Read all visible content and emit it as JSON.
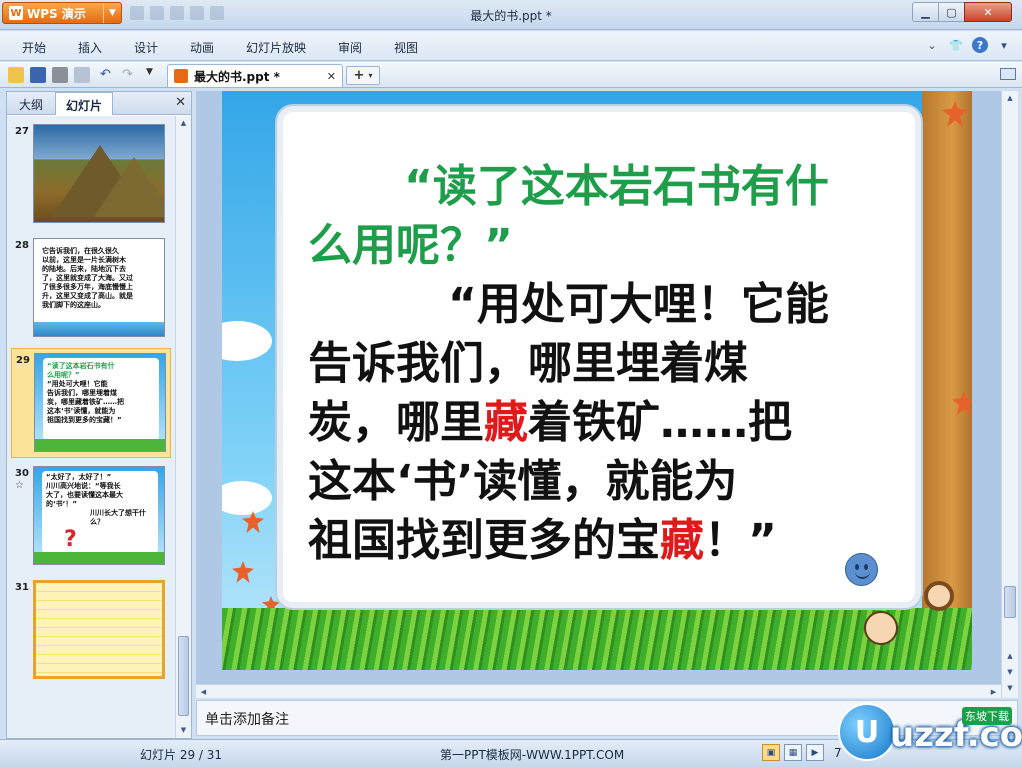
{
  "window": {
    "app_name": "WPS 演示",
    "app_logo": "W",
    "title": "最大的书.ppt *"
  },
  "menu": {
    "items": [
      "开始",
      "插入",
      "设计",
      "动画",
      "幻灯片放映",
      "审阅",
      "视图"
    ]
  },
  "toolbar": {
    "doc_tab_label": "最大的书.ppt *",
    "new_tab_label": "+"
  },
  "left_panel": {
    "tabs": [
      "大纲",
      "幻灯片"
    ],
    "slides": [
      {
        "num": "27",
        "lines": []
      },
      {
        "num": "28",
        "lines": [
          "它告诉我们，在很久很久",
          "以前，这里是一片长满树木",
          "的陆地。后来，陆地沉下去",
          "了，这里就变成了大海。又过",
          "了很多很多万年，海底慢慢上",
          "升，这里又变成了高山。就是",
          "我们脚下的这座山。"
        ]
      },
      {
        "num": "29",
        "lines": [
          "“读了这本岩石书有什",
          "么用呢？”",
          "“用处可大哩！它能",
          "告诉我们，哪里埋着煤",
          "炭，哪里藏着铁矿……把",
          "这本‘书’读懂，就能为",
          "祖国找到更多的宝藏！”"
        ]
      },
      {
        "num": "30",
        "star": "☆",
        "lines": [
          "“太好了，太好了！”",
          "川川高兴地说：“等我长",
          "大了，也要读懂这本最大",
          "的‘书’！”",
          "川川长大了想干什",
          "么？"
        ]
      },
      {
        "num": "31",
        "lines": []
      }
    ]
  },
  "slide": {
    "question": "“读了这本岩石书有什么用呢？”",
    "q_line1": "“读了这本岩石书有什",
    "q_line2": "么用呢？”",
    "a_line1": "“用处可大哩！它能",
    "a_line2": "告诉我们，哪里埋着煤",
    "a_line3a": "炭，哪里",
    "a_line3red": "藏",
    "a_line3b": "着铁矿……把",
    "a_line4": "这本‘书’读懂，就能为",
    "a_line5a": "祖国找到更多的宝",
    "a_line5red": "藏",
    "a_line5b": "！”"
  },
  "notes": {
    "placeholder": "单击添加备注"
  },
  "status": {
    "slide_counter": "幻灯片 29 / 31",
    "template": "第一PPT模板网-WWW.1PPT.COM",
    "zoom": "7"
  },
  "watermark": {
    "badge": "U",
    "text": "uzzf.com",
    "tag": "东坡下载"
  },
  "colors": {
    "accent_green": "#1e9e4a",
    "accent_red": "#e01a1a",
    "wps_orange": "#e46b13"
  }
}
